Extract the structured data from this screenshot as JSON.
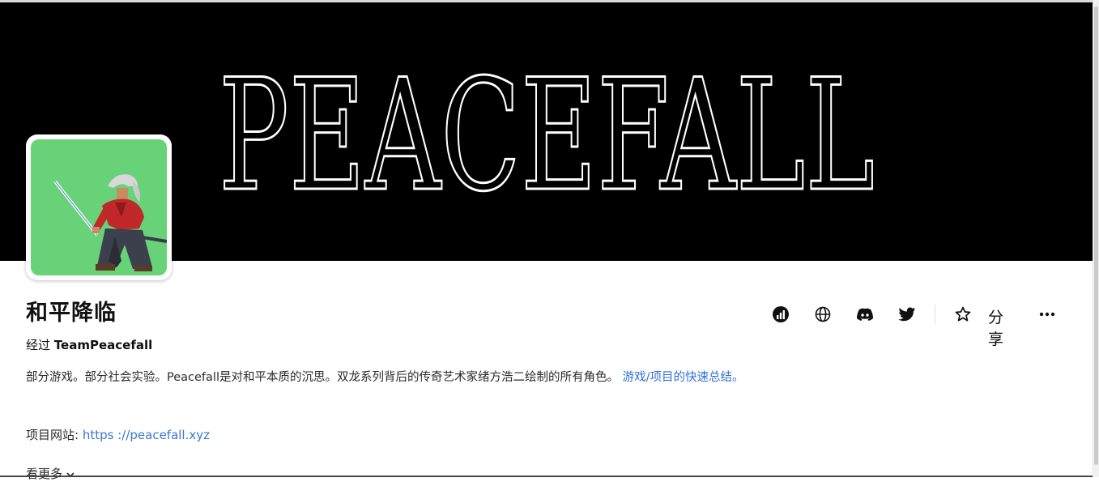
{
  "banner": {
    "logo_text": "PEACEFALL",
    "background": "#000000",
    "outline_color": "#ffffff"
  },
  "avatar": {
    "background": "#68d279",
    "depicts": "samurai-swordsman"
  },
  "collection": {
    "title": "和平降临",
    "byline_prefix": "经过",
    "creator": "TeamPeacefall",
    "description": "部分游戏。部分社会实验。Peacefall是对和平本质的沉思。双龙系列背后的传奇艺术家绪方浩二绘制的所有角色。",
    "description_link": "游戏/项目的快速总结。",
    "website_label": "项目网站:",
    "website_url": "https ://peacefall.xyz",
    "see_more": "看更多"
  },
  "actions": {
    "icons": [
      "stats-icon",
      "globe-icon",
      "discord-icon",
      "twitter-icon",
      "star-icon",
      "more-icon"
    ],
    "share_label": "分享"
  }
}
